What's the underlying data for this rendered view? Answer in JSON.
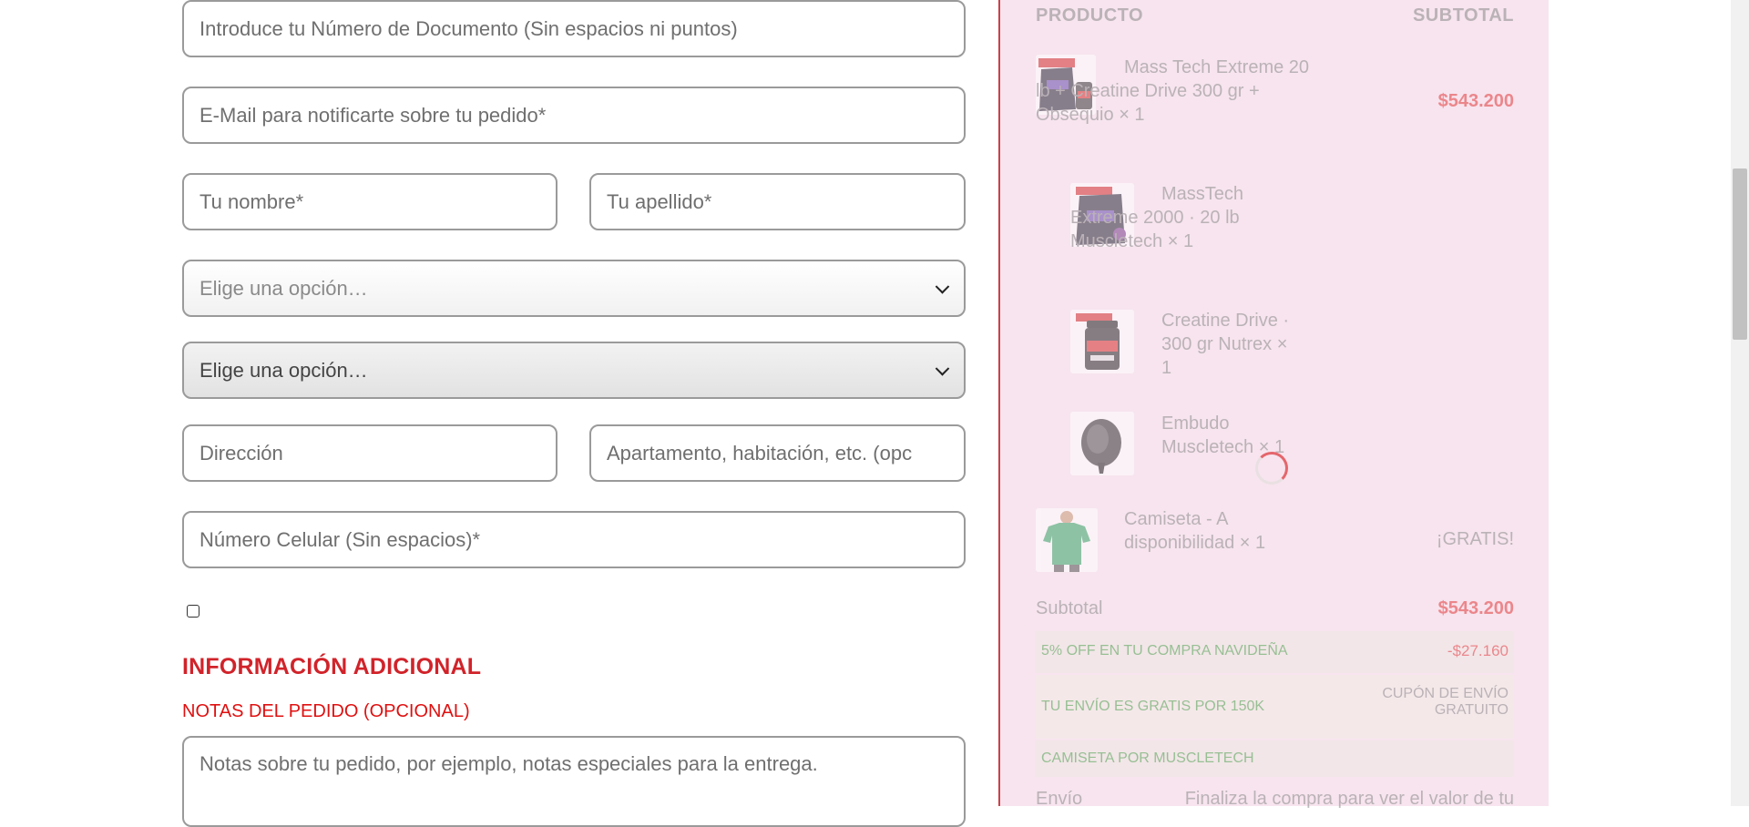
{
  "form": {
    "document_placeholder": "Introduce tu Número de Documento (Sin espacios ni puntos)",
    "email_placeholder": "E-Mail para notificarte sobre tu pedido*",
    "first_name_placeholder": "Tu nombre*",
    "last_name_placeholder": "Tu apellido*",
    "select1_value": "Elige una opción…",
    "select2_value": "Elige una opción…",
    "address_placeholder": "Dirección",
    "apartment_placeholder": "Apartamento, habitación, etc. (opc",
    "phone_placeholder": "Número Celular (Sin espacios)*",
    "additional_title": "INFORMACIÓN ADICIONAL",
    "notes_label": "NOTAS DEL PEDIDO (OPCIONAL)",
    "notes_placeholder": "Notas sobre tu pedido, por ejemplo, notas especiales para la entrega."
  },
  "summary": {
    "col_product": "PRODUCTO",
    "col_subtotal": "SUBTOTAL",
    "items": [
      {
        "name": "Mass Tech Extreme 20 lb + Creatine Drive 300 gr + Obsequio",
        "qty": "× 1",
        "price": "$543.200",
        "icon": "supplement-bundle-image"
      },
      {
        "name": "MassTech Extreme 2000 · 20 lb Muscletech",
        "qty": "× 1",
        "icon": "masstech-bag-image"
      },
      {
        "name": "Creatine Drive · 300 gr Nutrex",
        "qty": "× 1",
        "icon": "creatine-jar-image"
      },
      {
        "name": "Embudo Muscletech",
        "qty": "× 1",
        "icon": "funnel-image"
      },
      {
        "name": "Camiseta - A disponibilidad",
        "qty": "× 1",
        "price": "¡GRATIS!",
        "icon": "green-tshirt-image"
      }
    ],
    "subtotal_label": "Subtotal",
    "subtotal_value": "$543.200",
    "discount_label": "5% OFF EN TU COMPRA NAVIDEÑA",
    "discount_value": "-$27.160",
    "shipping_label": "TU ENVÍO ES GRATIS POR 150K",
    "shipping_value_line1": "CUPÓN DE ENVÍO",
    "shipping_value_line2": "GRATUITO",
    "shirt_promo_label": "CAMISETA POR MUSCLETECH",
    "footer_left": "Envío",
    "footer_right": "Finaliza la compra para ver el valor de tu"
  },
  "colors": {
    "accent_red": "#d1232a",
    "panel_pink": "#f7e4ee",
    "promo_green": "#4aa24a",
    "price_red": "#e23b3b"
  }
}
